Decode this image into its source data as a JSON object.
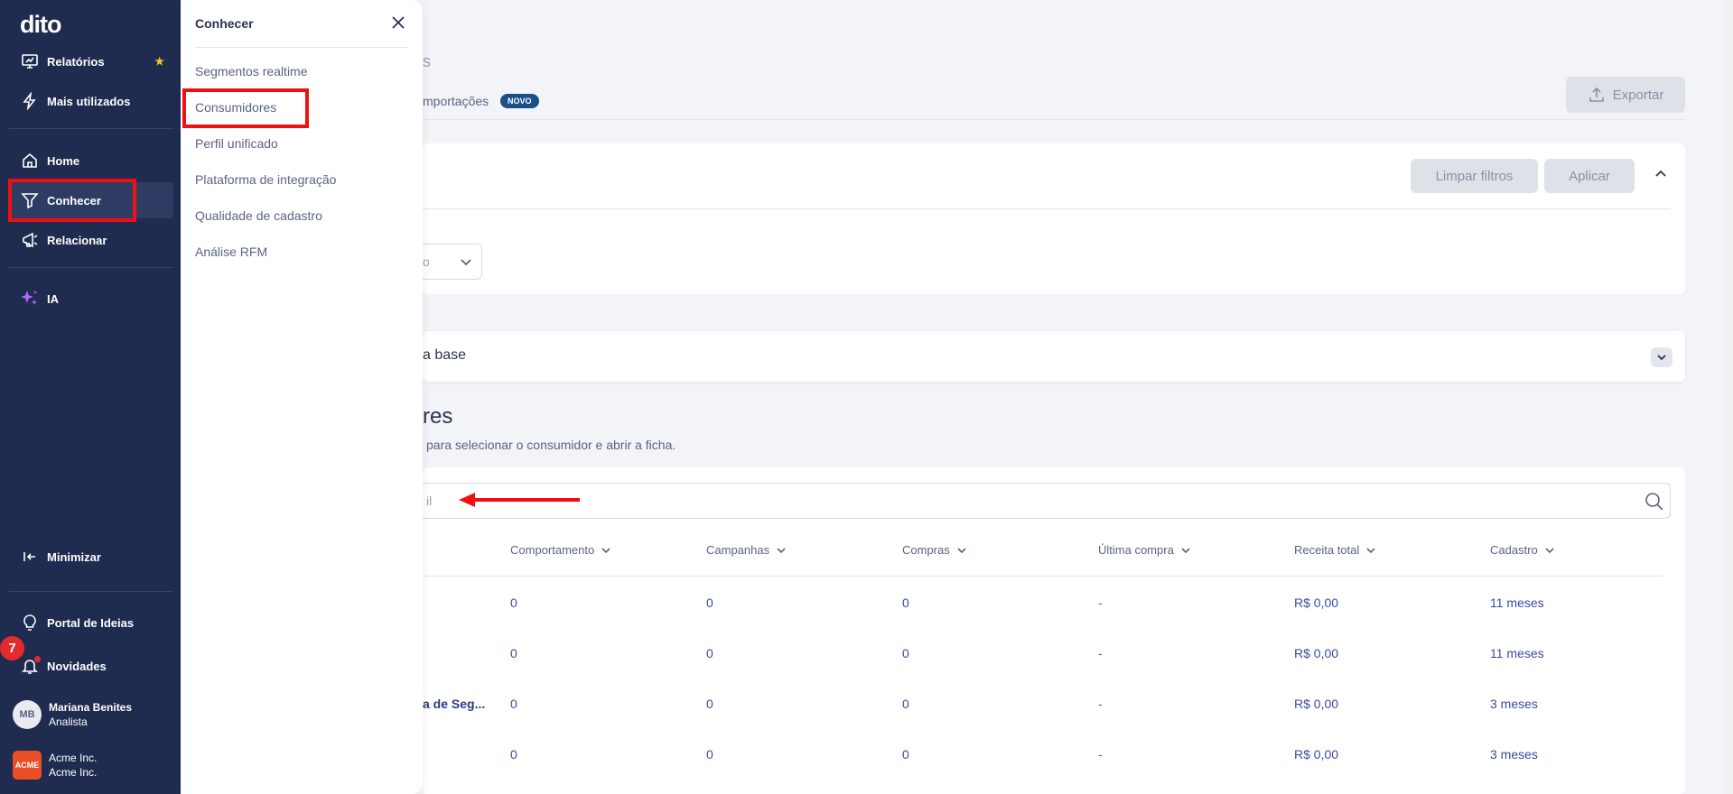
{
  "sidebar": {
    "logo": "dito",
    "items": [
      {
        "label": "Relatórios",
        "icon": "presentation-chart-icon"
      },
      {
        "label": "Mais utilizados",
        "icon": "lightning-icon"
      },
      {
        "label": "Home",
        "icon": "home-icon"
      },
      {
        "label": "Conhecer",
        "icon": "filter-icon"
      },
      {
        "label": "Relacionar",
        "icon": "megaphone-icon"
      },
      {
        "label": "IA",
        "icon": "sparkles-icon"
      }
    ],
    "minimize": "Minimizar",
    "ideas": "Portal de Ideias",
    "news": "Novidades",
    "news_count": "7",
    "user": {
      "initials": "MB",
      "name": "Mariana Benites",
      "role": "Analista"
    },
    "company": {
      "logo_text": "ACME",
      "name": "Acme Inc.",
      "sub": "Acme Inc."
    },
    "accent_color": "#f4c430",
    "bg_color": "#1f2c4f"
  },
  "flyout": {
    "title": "Conhecer",
    "items": [
      "Segmentos realtime",
      "Consumidores",
      "Perfil unificado",
      "Plataforma de integração",
      "Qualidade de cadastro",
      "Análise RFM"
    ]
  },
  "main": {
    "partial_title": "s",
    "tab_partial": "mportações",
    "novo_badge": "NOVO",
    "export_label": "Exportar",
    "clear_filters": "Limpar filtros",
    "apply": "Aplicar",
    "select_partial": "o",
    "base_partial": "a base",
    "heading_partial": "res",
    "subtitle_partial": "para selecionar o consumidor e abrir a ficha.",
    "search_partial": "il",
    "columns": [
      "Comportamento",
      "Campanhas",
      "Compras",
      "Última compra",
      "Receita total",
      "Cadastro"
    ],
    "rows": [
      {
        "name": "",
        "c1": "0",
        "c2": "0",
        "c3": "0",
        "c4": "-",
        "c5": "R$ 0,00",
        "c6": "11 meses"
      },
      {
        "name": "",
        "c1": "0",
        "c2": "0",
        "c3": "0",
        "c4": "-",
        "c5": "R$ 0,00",
        "c6": "11 meses"
      },
      {
        "name": "a de Seg...",
        "c1": "0",
        "c2": "0",
        "c3": "0",
        "c4": "-",
        "c5": "R$ 0,00",
        "c6": "3 meses"
      },
      {
        "name": "",
        "c1": "0",
        "c2": "0",
        "c3": "0",
        "c4": "-",
        "c5": "R$ 0,00",
        "c6": "3 meses"
      }
    ]
  }
}
